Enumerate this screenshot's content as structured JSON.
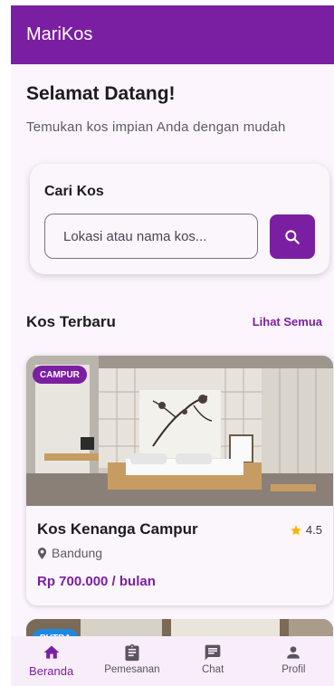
{
  "appbar": {
    "title": "MariKos"
  },
  "welcome": {
    "title": "Selamat Datang!",
    "subtitle": "Temukan kos impian Anda dengan mudah"
  },
  "search": {
    "title": "Cari Kos",
    "placeholder": "Lokasi atau nama kos...",
    "value": ""
  },
  "latest": {
    "title": "Kos Terbaru",
    "see_all": "Lihat Semua",
    "items": [
      {
        "badge": "CAMPUR",
        "name": "Kos Kenanga Campur",
        "rating": "4.5",
        "location": "Bandung",
        "price": "Rp 700.000 / bulan"
      },
      {
        "badge": "PUTRA"
      }
    ]
  },
  "bottom_nav": [
    {
      "label": "Beranda",
      "icon": "home-icon",
      "active": true
    },
    {
      "label": "Pemesanan",
      "icon": "clipboard-icon",
      "active": false
    },
    {
      "label": "Chat",
      "icon": "chat-icon",
      "active": false
    },
    {
      "label": "Profil",
      "icon": "person-icon",
      "active": false
    }
  ],
  "colors": {
    "primary": "#7b1fa2",
    "background": "#fcf5fd",
    "star": "#f5b400",
    "badge_putra": "#1e88e5"
  }
}
